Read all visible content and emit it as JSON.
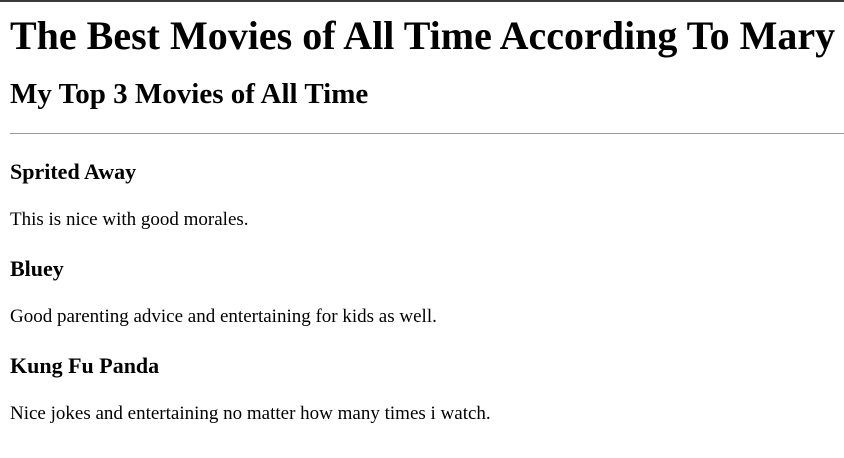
{
  "page": {
    "title": "The Best Movies of All Time According To Mary",
    "subtitle": "My Top 3 Movies of All Time"
  },
  "movies": [
    {
      "title": "Sprited Away",
      "description": "This is nice with good morales."
    },
    {
      "title": "Bluey",
      "description": "Good parenting advice and entertaining for kids as well."
    },
    {
      "title": "Kung Fu Panda",
      "description": "Nice jokes and entertaining no matter how many times i watch."
    }
  ]
}
